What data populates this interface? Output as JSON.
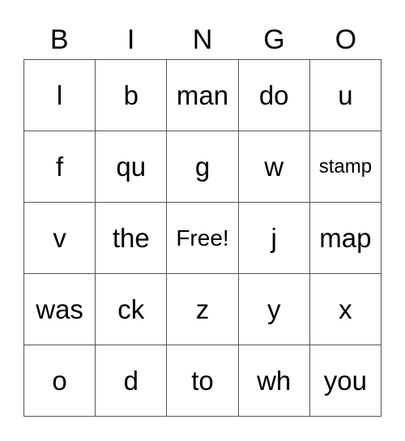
{
  "header": [
    "B",
    "I",
    "N",
    "G",
    "O"
  ],
  "cells": [
    [
      "l",
      "b",
      "man",
      "do",
      "u"
    ],
    [
      "f",
      "qu",
      "g",
      "w",
      "stamp"
    ],
    [
      "v",
      "the",
      "Free!",
      "j",
      "map"
    ],
    [
      "was",
      "ck",
      "z",
      "y",
      "x"
    ],
    [
      "o",
      "d",
      "to",
      "wh",
      "you"
    ]
  ]
}
